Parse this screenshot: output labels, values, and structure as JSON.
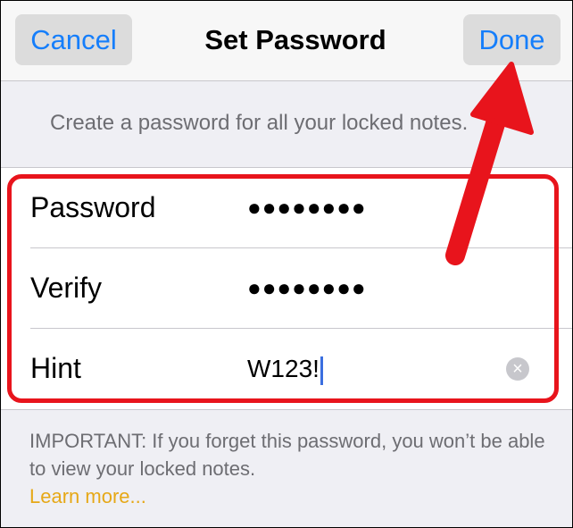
{
  "navbar": {
    "cancel_label": "Cancel",
    "title": "Set Password",
    "done_label": "Done"
  },
  "section_header": "Create a password for all your locked notes.",
  "form": {
    "password": {
      "label": "Password",
      "value": "●●●●●●●●"
    },
    "verify": {
      "label": "Verify",
      "value": "●●●●●●●●"
    },
    "hint": {
      "label": "Hint",
      "value": "W123!"
    }
  },
  "footer": {
    "important_text": "IMPORTANT: If you forget this password, you won’t be able to view your locked notes.",
    "learn_more": "Learn more..."
  },
  "colors": {
    "accent": "#157efb",
    "annotation_red": "#e8141c",
    "link_gold": "#e6a817"
  }
}
